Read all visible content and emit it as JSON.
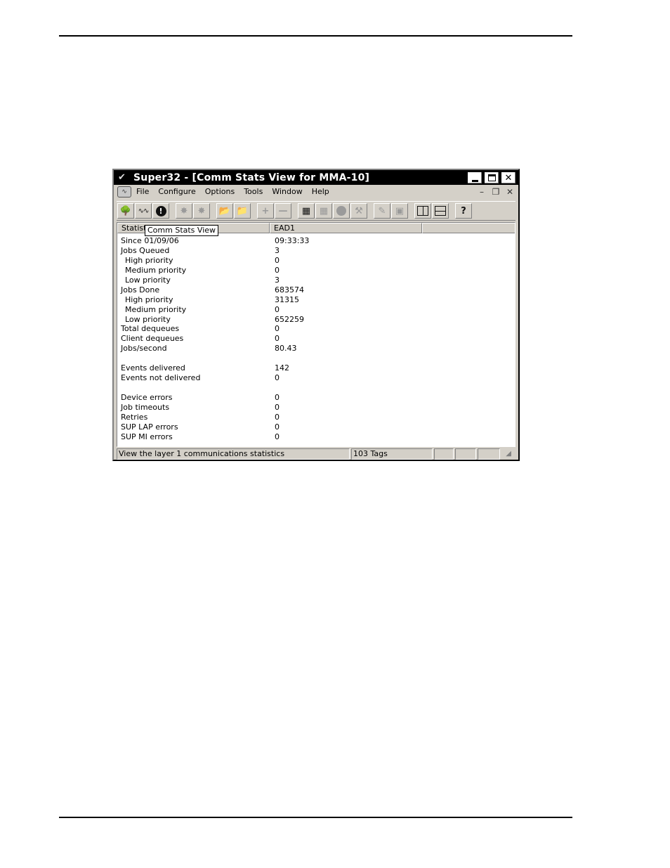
{
  "window": {
    "title": "Super32 - [Comm Stats View for MMA-10]"
  },
  "menu": {
    "items": [
      "File",
      "Configure",
      "Options",
      "Tools",
      "Window",
      "Help"
    ]
  },
  "mdi": {
    "min": "–",
    "restore": "❐",
    "close": "✕"
  },
  "toolbar": {
    "icons": [
      "tree-icon",
      "waveform-icon",
      "exclamation-icon",
      "network-disabled-icon",
      "network-disabled-icon",
      "folder-open-icon",
      "folder-export-icon",
      "add-icon",
      "remove-icon",
      "checklist-icon",
      "checklist-disabled-icon",
      "tag-disabled-icon",
      "tools-disabled-icon",
      "pencil-disabled-icon",
      "edit-disabled-icon",
      "split-vertical-icon",
      "split-horizontal-icon",
      "help-icon"
    ]
  },
  "grid": {
    "headers": [
      "Statist",
      "EAD1",
      ""
    ],
    "rows": [
      {
        "label": "Since 01/09/06",
        "value": "09:33:33",
        "indent": false
      },
      {
        "label": "Jobs Queued",
        "value": "3",
        "indent": false
      },
      {
        "label": "High priority",
        "value": "0",
        "indent": true
      },
      {
        "label": "Medium priority",
        "value": "0",
        "indent": true
      },
      {
        "label": "Low priority",
        "value": "3",
        "indent": true
      },
      {
        "label": "Jobs Done",
        "value": "683574",
        "indent": false
      },
      {
        "label": "High priority",
        "value": "31315",
        "indent": true
      },
      {
        "label": "Medium priority",
        "value": "0",
        "indent": true
      },
      {
        "label": "Low priority",
        "value": "652259",
        "indent": true
      },
      {
        "label": "Total dequeues",
        "value": "0",
        "indent": false
      },
      {
        "label": "Client dequeues",
        "value": "0",
        "indent": false
      },
      {
        "label": "Jobs/second",
        "value": "80.43",
        "indent": false
      },
      {
        "label": "",
        "value": "",
        "indent": false
      },
      {
        "label": "Events delivered",
        "value": "142",
        "indent": false
      },
      {
        "label": "Events not delivered",
        "value": "0",
        "indent": false
      },
      {
        "label": "",
        "value": "",
        "indent": false
      },
      {
        "label": "Device errors",
        "value": "0",
        "indent": false
      },
      {
        "label": "Job timeouts",
        "value": "0",
        "indent": false
      },
      {
        "label": "Retries",
        "value": "0",
        "indent": false
      },
      {
        "label": "SUP LAP errors",
        "value": "0",
        "indent": false
      },
      {
        "label": "SUP MI errors",
        "value": "0",
        "indent": false
      }
    ]
  },
  "tooltip": "Comm Stats View",
  "statusbar": {
    "message": "View the layer 1 communications statistics",
    "tags": "103 Tags"
  }
}
